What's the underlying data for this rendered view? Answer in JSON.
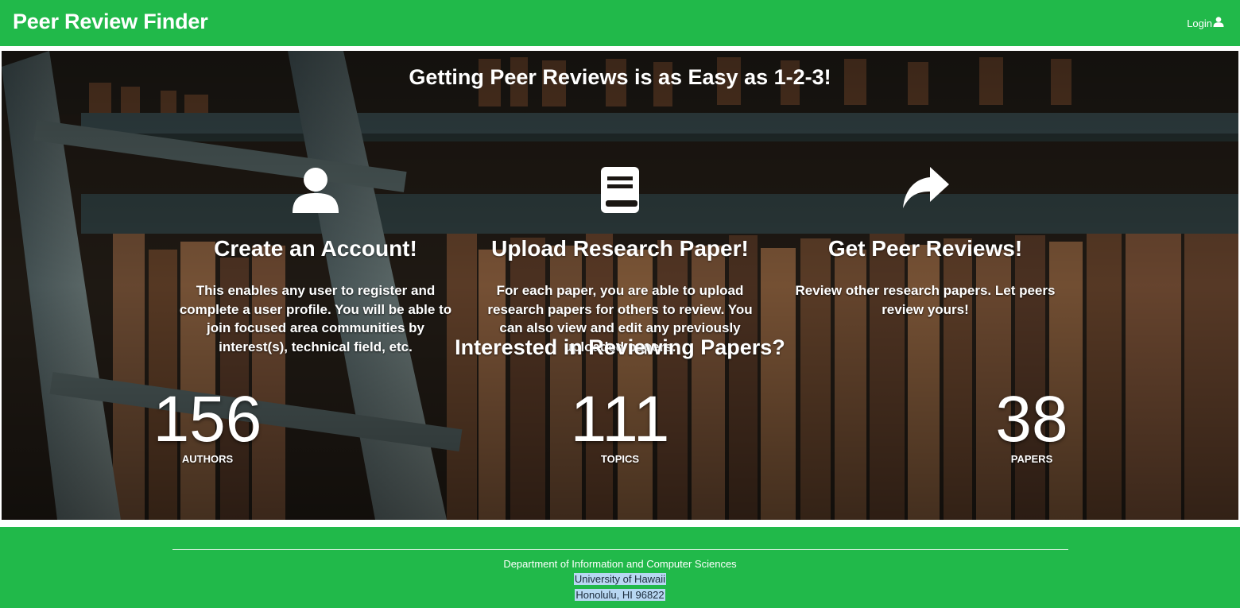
{
  "navbar": {
    "brand": "Peer Review Finder",
    "login_label": "Login",
    "login_icon": "user-icon",
    "color": "#21b94a"
  },
  "hero": {
    "title": "Getting Peer Reviews is as Easy as 1-2-3!",
    "steps": [
      {
        "icon": "user-icon",
        "title": "Create an Account!",
        "text": "This enables any user to register and complete a user profile. You will be able to join focused area communities by interest(s), technical field, etc."
      },
      {
        "icon": "book-icon",
        "title": "Upload Research Paper!",
        "text": "For each paper, you are able to upload research papers for others to review. You can also view and edit any previously uploaded papers."
      },
      {
        "icon": "share-arrow-icon",
        "title": "Get Peer Reviews!",
        "text": "Review other research papers. Let peers review yours!"
      }
    ],
    "interest_title": "Interested in Reviewing Papers?",
    "stats": [
      {
        "value": "156",
        "label": "AUTHORS"
      },
      {
        "value": "111",
        "label": "TOPICS"
      },
      {
        "value": "38",
        "label": "PAPERS"
      }
    ]
  },
  "footer": {
    "department": "Department of Information and Computer Sciences",
    "university": "University of Hawaii",
    "address": "Honolulu, HI 96822"
  }
}
